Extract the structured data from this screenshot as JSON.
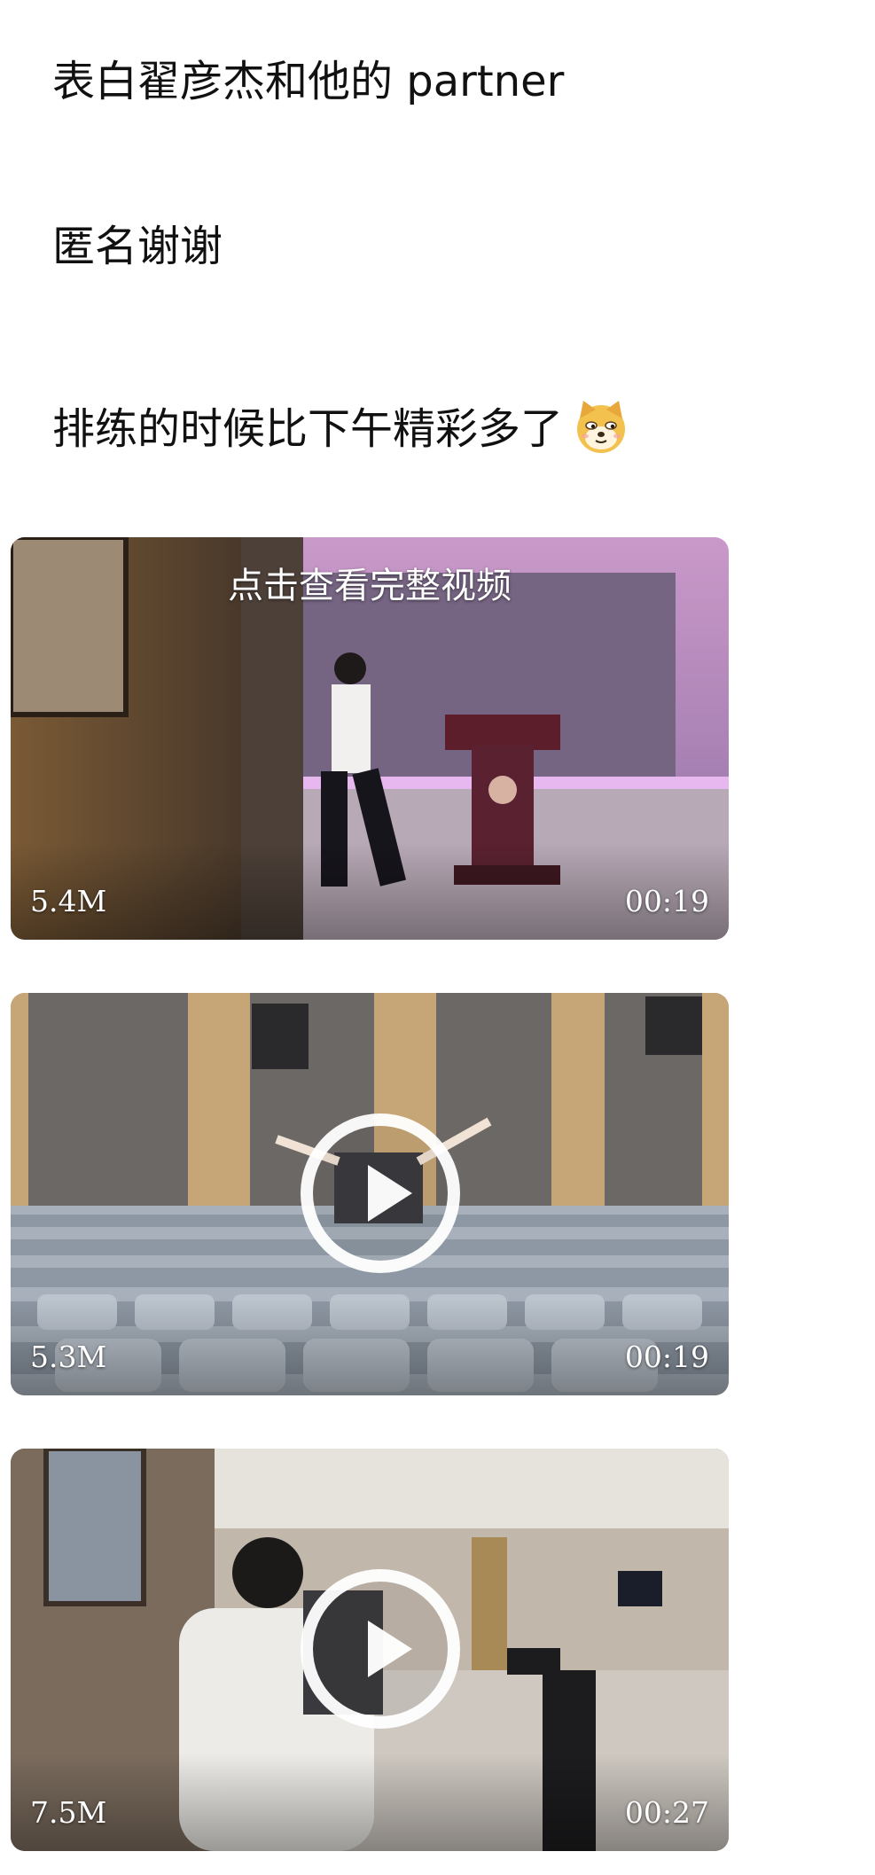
{
  "post": {
    "line1": "表白翟彦杰和他的 partner",
    "line2": "匿名谢谢",
    "line3": "排练的时候比下午精彩多了",
    "line3_emoji": "doge-emoji"
  },
  "videos": [
    {
      "caption": "点击查看完整视频",
      "size": "5.4M",
      "duration": "00:19",
      "has_play_icon": false
    },
    {
      "size": "5.3M",
      "duration": "00:19",
      "has_play_icon": true
    },
    {
      "size": "7.5M",
      "duration": "00:27",
      "has_play_icon": true
    }
  ],
  "colors": {
    "text": "#111111",
    "overlay_text": "#ffffff",
    "page_bg": "#ffffff"
  }
}
